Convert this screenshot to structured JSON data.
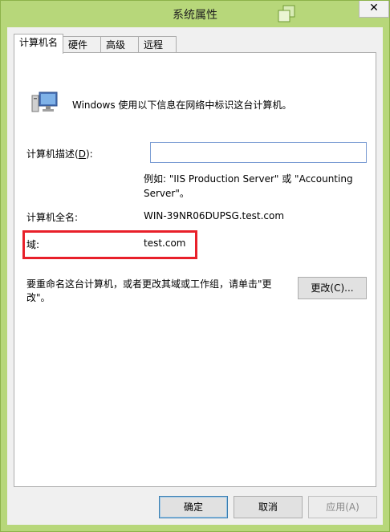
{
  "window": {
    "title": "系统属性",
    "close_glyph": "✕"
  },
  "tabs": [
    "计算机名",
    "硬件",
    "高级",
    "远程"
  ],
  "panel": {
    "intro": "Windows 使用以下信息在网络中标识这台计算机。",
    "description_label": "计算机描述(",
    "description_label_key": "D",
    "description_label_end": "):",
    "description_value": "",
    "example_line1": "例如: \"IIS Production Server\" 或 \"Accounting",
    "example_line2": "Server\"。",
    "fullname_label": "计算机全名:",
    "fullname_value": "WIN-39NR06DUPSG.test.com",
    "domain_label": "域:",
    "domain_value": "test.com",
    "rename_line1": "要重命名这台计算机，或者更改其域或工作组，请单击\"更",
    "rename_line2": "改\"。",
    "change_button": "更改(C)..."
  },
  "footer": {
    "ok": "确定",
    "cancel": "取消",
    "apply": "应用(A)"
  },
  "colors": {
    "titlebar": "#b7d77a",
    "highlight": "#e8202a",
    "input_border": "#7a9cd3"
  }
}
